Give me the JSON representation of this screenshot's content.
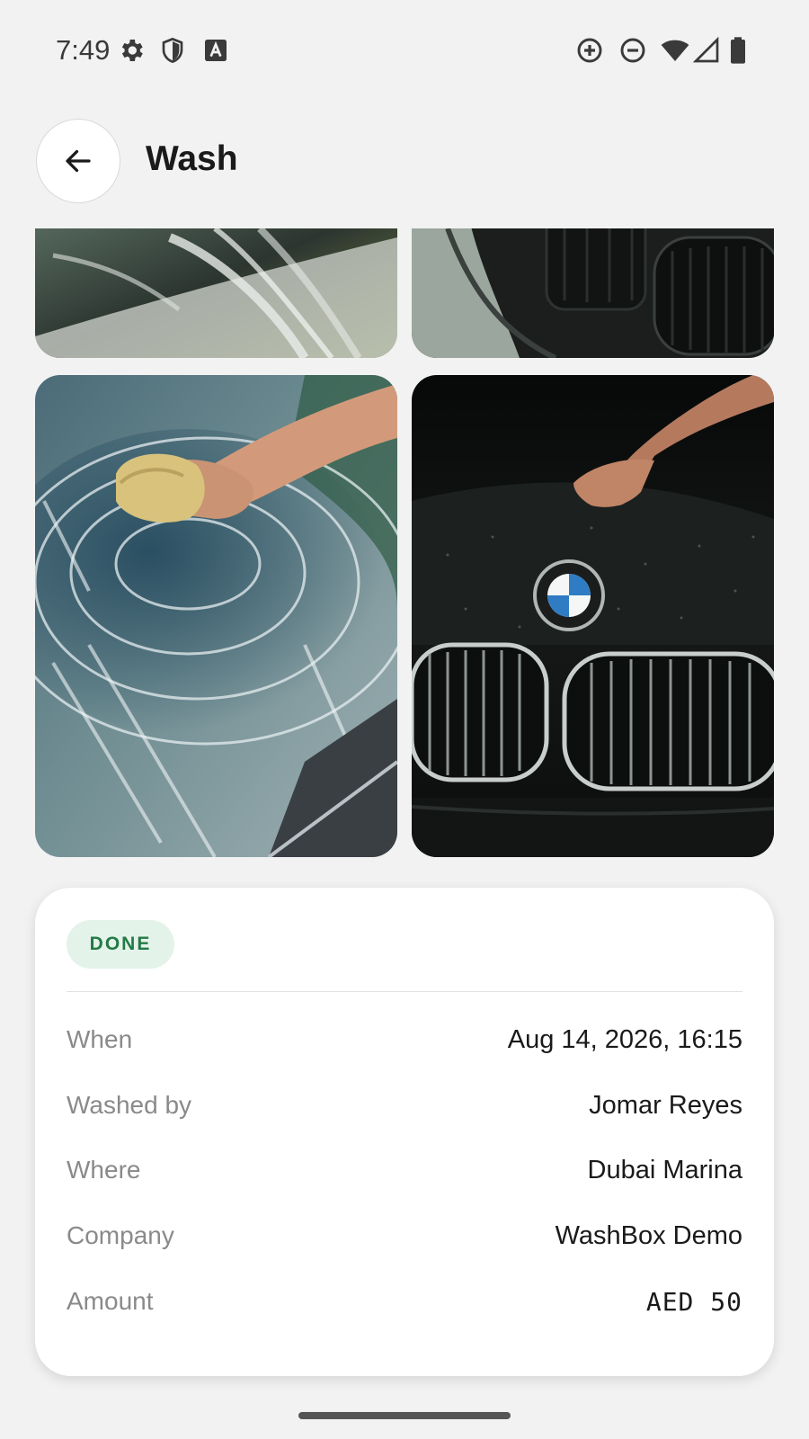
{
  "status_bar": {
    "time": "7:49",
    "left_icons": [
      "settings-icon",
      "shield-icon",
      "text-a-icon"
    ],
    "right_icons": [
      "data-saver-icon",
      "do-not-disturb-icon",
      "wifi-icon",
      "signal-icon",
      "battery-icon"
    ]
  },
  "header": {
    "back_icon": "arrow-left-icon",
    "title": "Wash"
  },
  "photos": [
    {
      "id": "photo-soapy-door",
      "alt": ""
    },
    {
      "id": "photo-black-car-front",
      "alt": ""
    },
    {
      "id": "photo-sponge-windshield",
      "alt": ""
    },
    {
      "id": "photo-bmw-grille",
      "alt": ""
    }
  ],
  "details": {
    "status": "DONE",
    "status_color": "#237a45",
    "status_bg": "#e4f3ea",
    "rows": [
      {
        "label": "When",
        "value": "Aug 14, 2026, 16:15"
      },
      {
        "label": "Washed by",
        "value": "Jomar Reyes"
      },
      {
        "label": "Where",
        "value": "Dubai Marina"
      },
      {
        "label": "Company",
        "value": "WashBox Demo"
      },
      {
        "label": "Amount",
        "value": "AED 50"
      }
    ]
  }
}
